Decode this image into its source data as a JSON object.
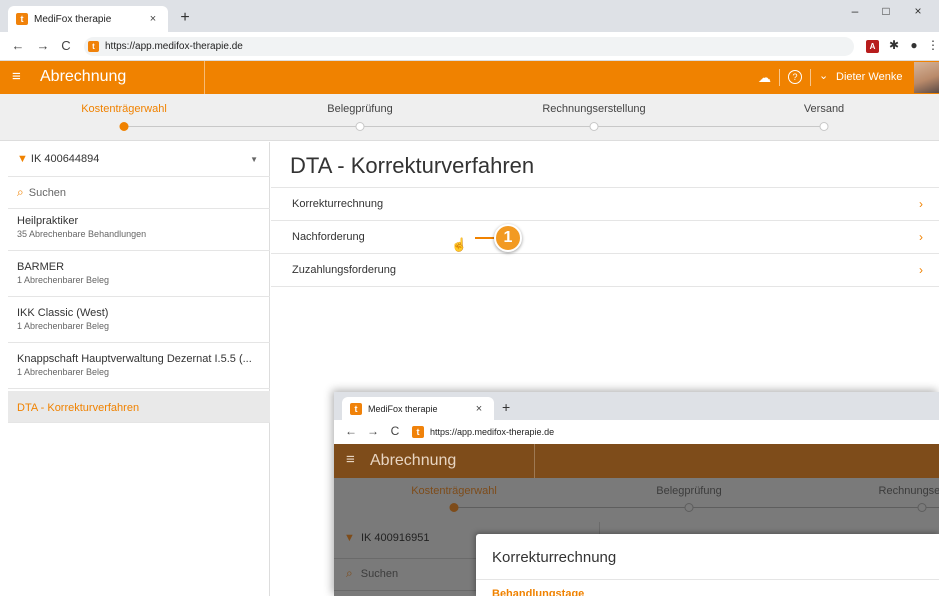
{
  "browser": {
    "tab_title": "MediFox therapie",
    "tab_close": "×",
    "new_tab": "+",
    "favicon": "t",
    "url": "https://app.medifox-therapie.de",
    "win_min": "–",
    "win_max": "□",
    "win_close": "×",
    "back": "←",
    "forward": "→",
    "reload": "C",
    "ext_pdf": "A",
    "ext_puzzle": "✱",
    "account": "●",
    "menu": "⋮"
  },
  "app": {
    "menu_icon": "≡",
    "title": "Abrechnung",
    "cloud_icon": "☁",
    "help_icon": "?",
    "user_chevron": "⌄",
    "user_name": "Dieter Wenke"
  },
  "stepper": {
    "steps": [
      "Kostenträgerwahl",
      "Belegprüfung",
      "Rechnungserstellung",
      "Versand"
    ],
    "active_index": 0
  },
  "sidebar": {
    "filter_label": "IK 400644894",
    "filter_chevron": "▼",
    "search_placeholder": "Suchen",
    "items": [
      {
        "name": "Heilpraktiker",
        "sub": "35 Abrechenbare Behandlungen"
      },
      {
        "name": "BARMER",
        "sub": "1 Abrechenbarer Beleg"
      },
      {
        "name": "IKK Classic (West)",
        "sub": "1 Abrechenbarer Beleg"
      },
      {
        "name": "Knappschaft Hauptverwaltung Dezernat I.5.5 (...",
        "sub": "1 Abrechenbarer Beleg"
      }
    ],
    "active_item": "DTA - Korrekturverfahren"
  },
  "main": {
    "title": "DTA - Korrekturverfahren",
    "rows": [
      "Korrekturrechnung",
      "Nachforderung",
      "Zuzahlungsforderung"
    ],
    "row_chevron": "›",
    "callout_number": "1"
  },
  "inset": {
    "tab_title": "MediFox therapie",
    "url": "https://app.medifox-therapie.de",
    "app_title": "Abrechnung",
    "steps": [
      "Kostenträgerwahl",
      "Belegprüfung",
      "Rechnungsers"
    ],
    "filter_label": "IK 400916951",
    "search_placeholder": "Suchen",
    "dialog_title": "Korrekturrechnung",
    "dialog_subtitle": "Behandlungstage"
  },
  "colors": {
    "brand_orange": "#f08200",
    "inset_overlay_brown": "#7e4c1a"
  }
}
